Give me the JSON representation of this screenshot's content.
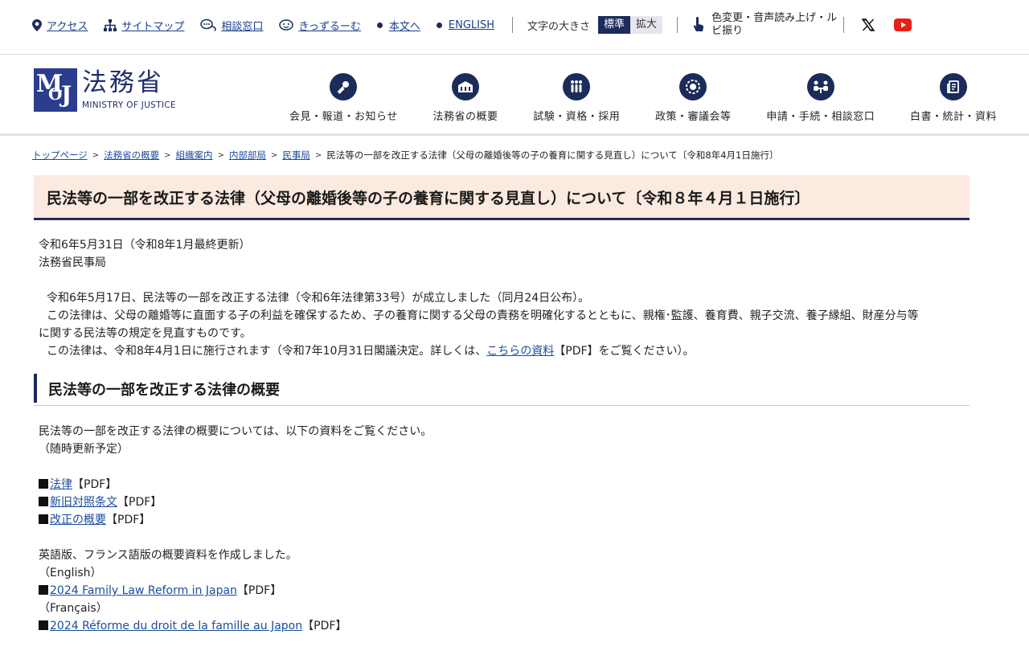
{
  "utility": {
    "links": [
      {
        "label": "アクセス",
        "icon": "map-pin-icon"
      },
      {
        "label": "サイトマップ",
        "icon": "sitemap-icon"
      },
      {
        "label": "相談窓口",
        "icon": "chat-icon"
      },
      {
        "label": "きっずるーむ",
        "icon": "kids-icon"
      },
      {
        "label": "本文へ",
        "icon": "dot"
      },
      {
        "label": "ENGLISH",
        "icon": "dot"
      }
    ],
    "font_size_label": "文字の大きさ",
    "font_standard": "標準",
    "font_large": "拡大",
    "assist_label": "色変更・音声読み上げ・ルビ振り"
  },
  "logo": {
    "jp": "法務省",
    "en": "MINISTRY OF JUSTICE"
  },
  "nav": [
    {
      "label": "会見・報道・お知らせ",
      "icon": "microphone-icon"
    },
    {
      "label": "法務省の概要",
      "icon": "building-icon"
    },
    {
      "label": "試験・資格・採用",
      "icon": "people-icon"
    },
    {
      "label": "政策・審議会等",
      "icon": "gear-circle-icon"
    },
    {
      "label": "申請・手続・相談窓口",
      "icon": "consultation-icon"
    },
    {
      "label": "白書・統計・資料",
      "icon": "document-icon"
    }
  ],
  "breadcrumb": {
    "links": [
      "トップページ",
      "法務省の概要",
      "組織案内",
      "内部部局",
      "民事局"
    ],
    "current": "民法等の一部を改正する法律（父母の離婚後等の子の養育に関する見直し）について〔令和8年4月1日施行〕"
  },
  "title": "民法等の一部を改正する法律（父母の離婚後等の子の養育に関する見直し）について〔令和８年４月１日施行〕",
  "meta": {
    "date": "令和6年5月31日（令和8年1月最終更新）",
    "department": "法務省民事局"
  },
  "intro": {
    "p1": "令和6年5月17日、民法等の一部を改正する法律（令和6年法律第33号）が成立しました（同月24日公布）。",
    "p2a": "この法律は、父母の離婚等に直面する子の利益を確保するため、子の養育に関する父母の責務を明確化するとともに、親権･監護、養育費、親子交流、養子縁組、財産分与等",
    "p2b": "に関する民法等の規定を見直すものです。",
    "p3_before": "この法律は、令和8年4月1日に施行されます（令和7年10月31日閣議決定。詳しくは、",
    "p3_link": "こちらの資料",
    "p3_after": "【PDF】をご覧ください）。"
  },
  "section": {
    "heading": "民法等の一部を改正する法律の概要",
    "lead1": "民法等の一部を改正する法律の概要については、以下の資料をご覧ください。",
    "lead2": "（随時更新予定）",
    "docs": [
      {
        "link": "法律",
        "suffix": "【PDF】"
      },
      {
        "link": "新旧対照条文",
        "suffix": "【PDF】"
      },
      {
        "link": "改正の概要",
        "suffix": "【PDF】"
      }
    ],
    "foreign_lead": "英語版、フランス語版の概要資料を作成しました。",
    "english_label": "（English）",
    "english_link": "2024 Family Law Reform in Japan",
    "english_suffix": "【PDF】",
    "french_label": "（Français）",
    "french_link": "2024 Réforme du droit de la famille au Japon",
    "french_suffix": "【PDF】"
  }
}
